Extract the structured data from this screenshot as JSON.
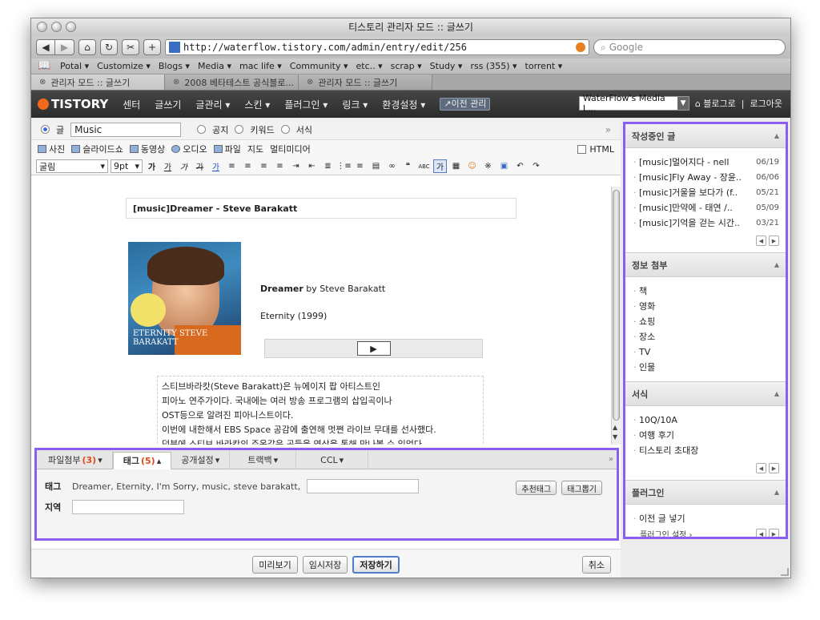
{
  "window": {
    "title": "티스토리 관리자 모드 :: 글쓰기"
  },
  "browser": {
    "url": "http://waterflow.tistory.com/admin/entry/edit/256",
    "search_placeholder": "Google",
    "bookmarks": [
      "Potal ▾",
      "Customize ▾",
      "Blogs ▾",
      "Media ▾",
      "mac life ▾",
      "Community ▾",
      "etc.. ▾",
      "scrap ▾",
      "Study ▾",
      "rss (355) ▾",
      "torrent ▾"
    ],
    "tabs": [
      "관리자 모드 :: 글쓰기",
      "2008 베타테스트 공식블로...",
      "관리자 모드 :: 글쓰기"
    ]
  },
  "tistory_nav": {
    "logo": "TISTORY",
    "items": [
      "센터",
      "글쓰기",
      "글관리 ▾",
      "스킨 ▾",
      "플러그인 ▾",
      "링크 ▾",
      "환경설정 ▾"
    ],
    "prev_admin": "↗이전 관리",
    "blog_select": "WaterFlow's Media L...",
    "to_blog": "⌂ 블로그로",
    "logout": "로그아웃"
  },
  "editor": {
    "type_post": "글",
    "category": "Music",
    "type_notice": "공지",
    "type_keyword": "키워드",
    "type_form": "서식",
    "expand": "»",
    "media": [
      "사진",
      "슬라이드쇼",
      "동영상",
      "오디오",
      "파일",
      "지도",
      "멀티미디어"
    ],
    "html_label": "HTML",
    "font": "굴림",
    "size": "9pt",
    "fmt_buttons": [
      "가",
      "가",
      "가",
      "가",
      "가",
      "≡",
      "≡",
      "≡",
      "≡",
      "⇥",
      "⇤",
      "≣",
      "⋮≡",
      "≡",
      "▤",
      "∞",
      "❝",
      "ABC",
      "가",
      "▦",
      "☺",
      "※",
      "▣",
      "↶",
      "↷"
    ]
  },
  "post": {
    "title": "[music]Dreamer - Steve Barakatt",
    "album_title": "Dreamer",
    "album_by": " by Steve Barakatt",
    "album_sub": "Eternity (1999)",
    "cover_text": "ETERNITY STEVE BARAKATT",
    "body_lines": [
      "스티브바라캇(Steve Barakatt)은 뉴에이지 팝 아티스트인",
      "피아노 연주가이다. 국내에는 여러 방송 프로그램의 삽입곡이나",
      "OST등으로 알려진 피아니스트이다.",
      "이번에 내한해서 EBS Space 공감에 출연해 멋쪈 라이브 무대를 선사했다.",
      "덕분에 스티브 바라캇의 주옥같은 곡들을 영상을 통해 만나볼 수 있었다."
    ]
  },
  "panel": {
    "tabs": [
      {
        "label": "파일첨부",
        "count": "(3)",
        "arrow": "▾"
      },
      {
        "label": "태그",
        "count": "(5)",
        "arrow": "▴"
      },
      {
        "label": "공개설정",
        "count": "",
        "arrow": "▾"
      },
      {
        "label": "트랙백",
        "count": "",
        "arrow": "▾"
      },
      {
        "label": "CCL",
        "count": "",
        "arrow": "▾"
      }
    ],
    "collapse": "»",
    "tag_label": "태그",
    "tag_values": "Dreamer, Eternity, I'm Sorry, music, steve barakatt,",
    "recommend_tag": "추천태그",
    "extract_tag": "태그뽑기",
    "location_label": "지역"
  },
  "actions": {
    "preview": "미리보기",
    "temp_save": "임시저장",
    "save": "저장하기",
    "cancel": "취소"
  },
  "sidebar": {
    "drafts": {
      "title": "작성중인 글",
      "items": [
        {
          "t": "[music]멀어지다 - nell",
          "d": "06/19"
        },
        {
          "t": "[music]Fly Away - 장윤..",
          "d": "06/06"
        },
        {
          "t": "[music]거울을 보다가 (f..",
          "d": "05/21"
        },
        {
          "t": "[music]만약에 - 태연 /..",
          "d": "05/09"
        },
        {
          "t": "[music]기억을 걷는 시간..",
          "d": "03/21"
        }
      ]
    },
    "info": {
      "title": "정보 첨부",
      "items": [
        "책",
        "영화",
        "쇼핑",
        "장소",
        "TV",
        "인물"
      ]
    },
    "forms": {
      "title": "서식",
      "items": [
        "10Q/10A",
        "여행 후기",
        "티스토리 초대장"
      ]
    },
    "plugins": {
      "title": "플러그인",
      "items": [
        "이전 글 넣기"
      ],
      "settings": "플러그인 설정 ›"
    }
  }
}
